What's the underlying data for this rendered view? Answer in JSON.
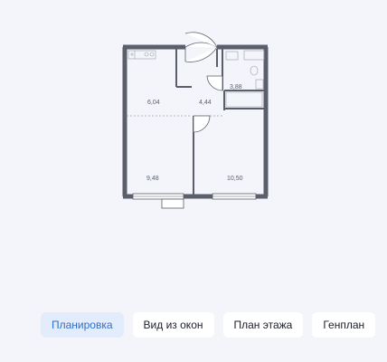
{
  "floorplan": {
    "rooms": [
      {
        "id": "kitchen",
        "area": "6,04"
      },
      {
        "id": "hall",
        "area": "4,44"
      },
      {
        "id": "bathroom",
        "area": "3,88"
      },
      {
        "id": "living",
        "area": "9,48"
      },
      {
        "id": "bedroom",
        "area": "10,50"
      }
    ]
  },
  "tabs": [
    {
      "label": "Планировка",
      "active": true
    },
    {
      "label": "Вид из окон",
      "active": false
    },
    {
      "label": "План этажа",
      "active": false
    },
    {
      "label": "Генплан",
      "active": false
    }
  ],
  "colors": {
    "wall": "#5a5f6b",
    "window": "#ffffff",
    "accent": "#2f6fcf",
    "active_tab_bg": "#e3ecfb",
    "page_bg": "#f3f5fa"
  }
}
